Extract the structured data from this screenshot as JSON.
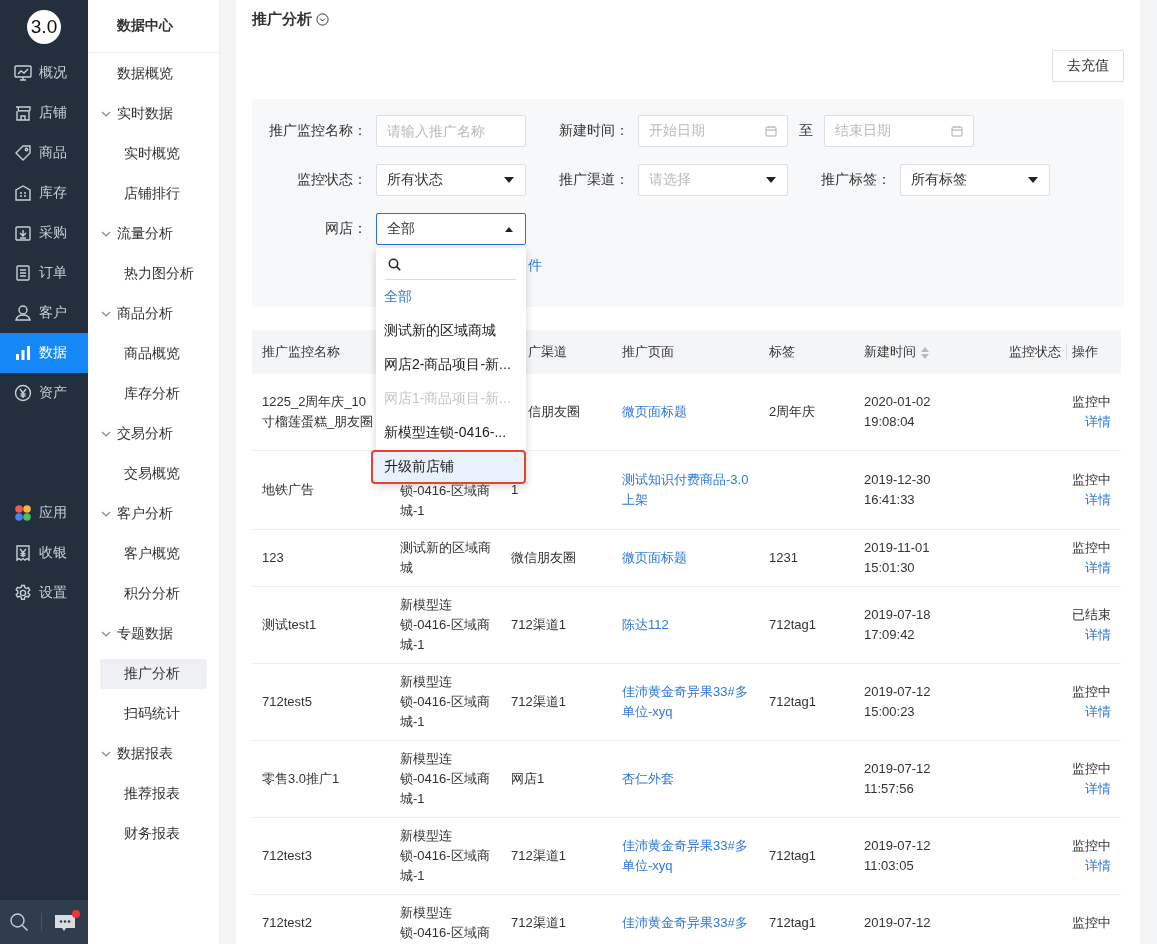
{
  "nav": {
    "logo": "3.0",
    "items": [
      {
        "label": "概况",
        "selected": false
      },
      {
        "label": "店铺",
        "selected": false
      },
      {
        "label": "商品",
        "selected": false
      },
      {
        "label": "库存",
        "selected": false
      },
      {
        "label": "采购",
        "selected": false
      },
      {
        "label": "订单",
        "selected": false
      },
      {
        "label": "客户",
        "selected": false
      },
      {
        "label": "数据",
        "selected": true
      },
      {
        "label": "资产",
        "selected": false
      }
    ],
    "lower_items": [
      {
        "label": "应用",
        "selected": false
      },
      {
        "label": "收银",
        "selected": false
      },
      {
        "label": "设置",
        "selected": false
      }
    ],
    "notification": true
  },
  "subnav": {
    "title": "数据中心",
    "items": [
      {
        "label": "数据概览",
        "selected": false
      },
      {
        "label": "实时数据",
        "expanded": true,
        "children": [
          {
            "label": "实时概览",
            "selected": false
          },
          {
            "label": "店铺排行",
            "selected": false
          }
        ]
      },
      {
        "label": "流量分析",
        "expanded": true,
        "children": [
          {
            "label": "热力图分析",
            "selected": false
          }
        ]
      },
      {
        "label": "商品分析",
        "expanded": true,
        "children": [
          {
            "label": "商品概览",
            "selected": false
          },
          {
            "label": "库存分析",
            "selected": false
          }
        ]
      },
      {
        "label": "交易分析",
        "expanded": true,
        "children": [
          {
            "label": "交易概览",
            "selected": false
          }
        ]
      },
      {
        "label": "客户分析",
        "expanded": true,
        "children": [
          {
            "label": "客户概览",
            "selected": false
          },
          {
            "label": "积分分析",
            "selected": false
          }
        ]
      },
      {
        "label": "专题数据",
        "expanded": true,
        "children": [
          {
            "label": "推广分析",
            "selected": true
          },
          {
            "label": "扫码统计",
            "selected": false
          }
        ]
      },
      {
        "label": "数据报表",
        "expanded": true,
        "children": [
          {
            "label": "推荐报表",
            "selected": false
          },
          {
            "label": "财务报表",
            "selected": false
          }
        ]
      }
    ]
  },
  "page": {
    "title": "推广分析",
    "recharge_button": "去充值"
  },
  "filters": {
    "rows": [
      [
        {
          "kind": "text",
          "label": "推广监控名称：",
          "placeholder": "请输入推广名称"
        },
        {
          "kind": "daterange",
          "label": "新建时间：",
          "start_placeholder": "开始日期",
          "separator": "至",
          "end_placeholder": "结束日期"
        }
      ],
      [
        {
          "kind": "select",
          "label": "监控状态：",
          "value": "所有状态"
        },
        {
          "kind": "select",
          "label": "推广渠道：",
          "placeholder": "请选择"
        },
        {
          "kind": "select",
          "label": "推广标签：",
          "value": "所有标签"
        }
      ],
      [
        {
          "kind": "select",
          "label": "网店：",
          "value": "全部",
          "open": true
        }
      ]
    ],
    "more_link": "件",
    "dropdown": {
      "options": [
        {
          "label": "全部",
          "selected": true,
          "disabled": false,
          "annotated": false
        },
        {
          "label": "测试新的区域商城",
          "selected": false,
          "disabled": false,
          "annotated": false
        },
        {
          "label": "网店2-商品项目-新...",
          "selected": false,
          "disabled": false,
          "annotated": false
        },
        {
          "label": "网店1-商品项目-新...",
          "selected": false,
          "disabled": true,
          "annotated": false
        },
        {
          "label": "新模型连锁-0416-...",
          "selected": false,
          "disabled": false,
          "annotated": false
        },
        {
          "label": "升级前店铺",
          "selected": false,
          "disabled": false,
          "annotated": true
        }
      ]
    }
  },
  "table": {
    "columns": [
      {
        "label": "推广监控名称"
      },
      {},
      {
        "label": "广渠道",
        "partial": true
      },
      {
        "label": "推广页面"
      },
      {
        "label": "标签"
      },
      {
        "label": "新建时间",
        "sortable": true
      },
      {
        "label": "监控状态"
      },
      {
        "label": "操作"
      }
    ],
    "rows": [
      {
        "name": "1225_2周年庆_10寸榴莲蛋糕_朋友圈",
        "channel": "信朋友圈",
        "channel_partial": true,
        "page": "微页面标题",
        "tag": "2周年庆",
        "time": "2020-01-02 19:08:04",
        "status": "监控中",
        "action": "详情"
      },
      {
        "name": "地铁广告",
        "shop": "锁-0416-区域商城-1",
        "shop_partial": true,
        "channel": "1",
        "page": "测试知识付费商品-3.0上架",
        "time": "2019-12-30 16:41:33",
        "status": "监控中",
        "action": "详情"
      },
      {
        "name": "123",
        "shop": "测试新的区域商城",
        "channel": "微信朋友圈",
        "page": "微页面标题",
        "tag": "1231",
        "time": "2019-11-01 15:01:30",
        "status": "监控中",
        "action": "详情"
      },
      {
        "name": "测试test1",
        "shop": "新模型连锁-0416-区域商城-1",
        "channel": "712渠道1",
        "page": "陈达112",
        "tag": "712tag1",
        "time": "2019-07-18 17:09:42",
        "status": "已结束",
        "action": "详情"
      },
      {
        "name": "712test5",
        "shop": "新模型连锁-0416-区域商城-1",
        "channel": "712渠道1",
        "page": "佳沛黄金奇异果33#多单位-xyq",
        "tag": "712tag1",
        "time": "2019-07-12 15:00:23",
        "status": "监控中",
        "action": "详情"
      },
      {
        "name": "零售3.0推广1",
        "shop": "新模型连锁-0416-区域商城-1",
        "channel": "网店1",
        "page": "杏仁外套",
        "time": "2019-07-12 11:57:56",
        "status": "监控中",
        "action": "详情"
      },
      {
        "name": "712test3",
        "shop": "新模型连锁-0416-区域商城-1",
        "channel": "712渠道1",
        "page": "佳沛黄金奇异果33#多单位-xyq",
        "tag": "712tag1",
        "time": "2019-07-12 11:03:05",
        "status": "监控中",
        "action": "详情"
      },
      {
        "name": "712test2",
        "shop": "新模型连锁-0416-区域商",
        "channel": "712渠道1",
        "page": "佳沛黄金奇异果33#多",
        "tag": "712tag1",
        "time": "2019-07-12",
        "status": "监控中"
      }
    ]
  }
}
